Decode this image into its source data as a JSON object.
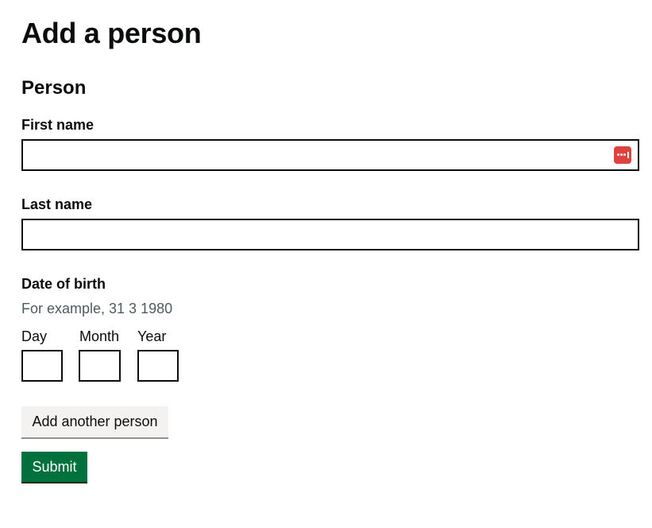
{
  "page": {
    "title": "Add a person"
  },
  "person": {
    "section_title": "Person",
    "first_name": {
      "label": "First name",
      "value": ""
    },
    "last_name": {
      "label": "Last name",
      "value": ""
    },
    "date_of_birth": {
      "label": "Date of birth",
      "hint": "For example, 31 3 1980",
      "day": {
        "label": "Day",
        "value": ""
      },
      "month": {
        "label": "Month",
        "value": ""
      },
      "year": {
        "label": "Year",
        "value": ""
      }
    }
  },
  "actions": {
    "add_another_label": "Add another person",
    "submit_label": "Submit"
  },
  "icons": {
    "password_manager": "password-manager-icon"
  },
  "colors": {
    "primary_button": "#00703c",
    "secondary_button": "#f3f2f1",
    "password_manager_icon": "#e0413f",
    "hint_text": "#505a5f"
  }
}
